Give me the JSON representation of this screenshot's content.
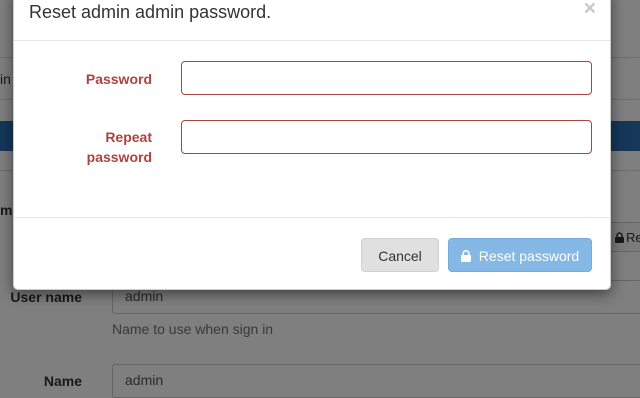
{
  "modal": {
    "title": "Reset admin admin password.",
    "close_glyph": "×",
    "fields": [
      {
        "label": "Password",
        "value": ""
      },
      {
        "label_line1": "Repeat",
        "label_line2": "password",
        "value": ""
      }
    ],
    "cancel_label": "Cancel",
    "reset_label": "Reset password",
    "reset_icon": "lock-icon"
  },
  "background": {
    "left_fragment_1": "in",
    "left_fragment_2": "min",
    "right_button_label": "Re",
    "right_button_icon": "lock-icon",
    "user_name_label": "User name",
    "user_name_value": "admin",
    "user_name_help": "Name to use when sign in",
    "name_label": "Name",
    "name_value": "admin",
    "accent_bar_color": "#2a6fb0"
  },
  "colors": {
    "error": "#a94442",
    "primary_disabled": "#7fb5e3"
  }
}
